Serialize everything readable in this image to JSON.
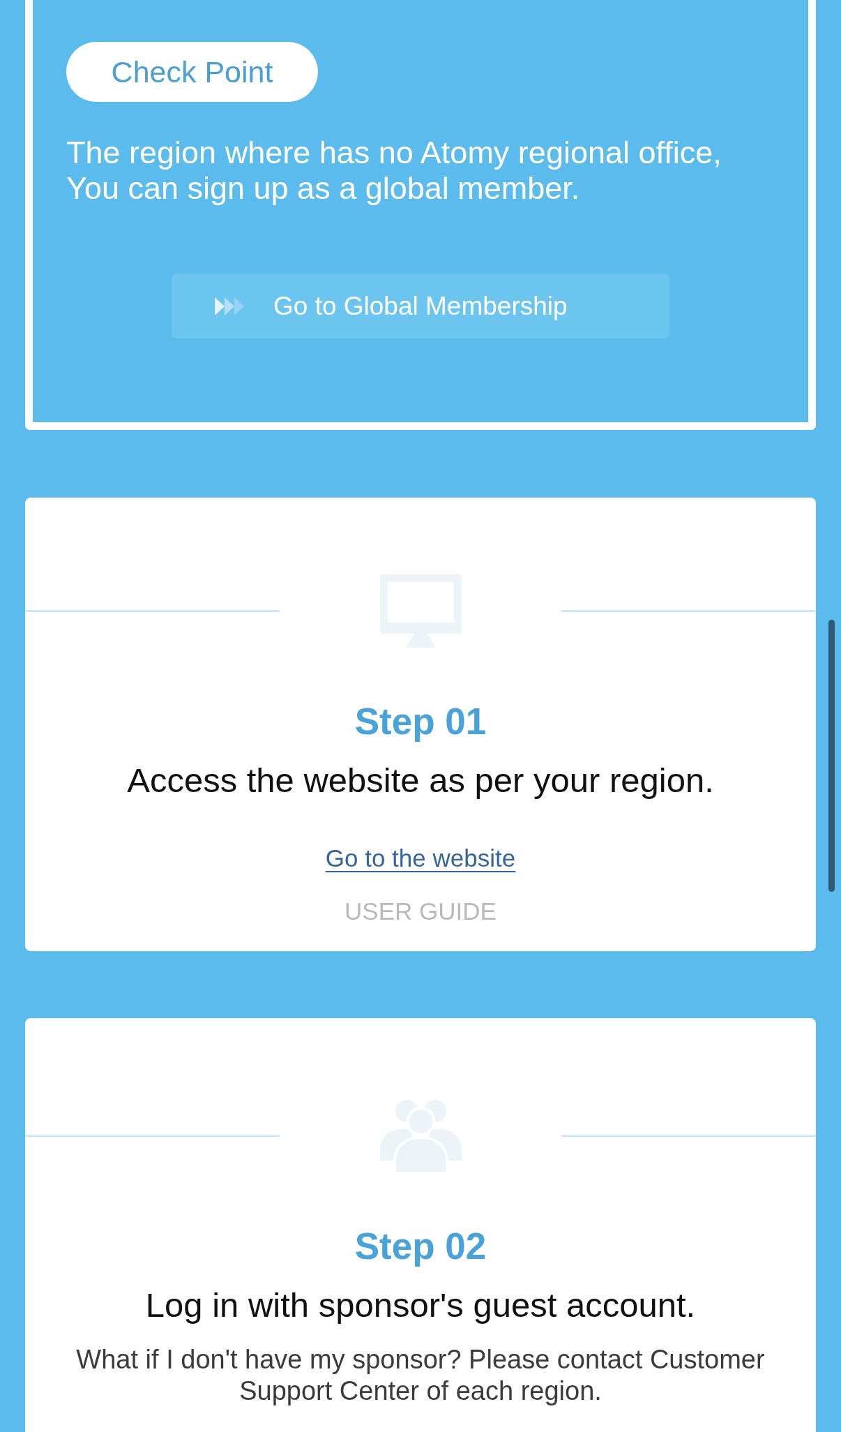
{
  "check_point": {
    "badge": "Check Point",
    "message": [
      "The region where has no Atomy regional office,",
      "You can sign up as a global member."
    ],
    "button": "Go to Global Membership"
  },
  "steps": [
    {
      "label": "Step 01",
      "title": "Access the website as per your region.",
      "links": [
        {
          "label": "Go to the website",
          "disabled": false
        },
        {
          "label": "USER GUIDE",
          "disabled": true
        }
      ]
    },
    {
      "label": "Step 02",
      "title": "Log in with sponsor's guest account.",
      "note": "What if I don't have my sponsor? Please contact Customer Support Center of each region."
    }
  ]
}
